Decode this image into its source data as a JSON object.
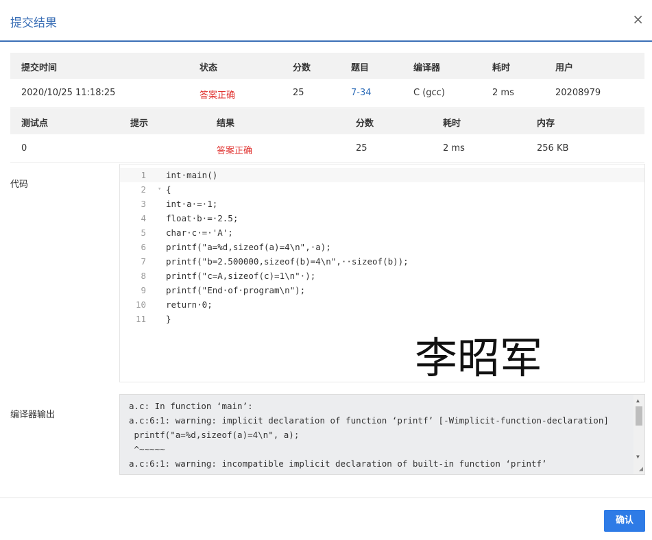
{
  "dialog": {
    "title": "提交结果",
    "close_glyph": "×",
    "confirm_label": "确认"
  },
  "submission": {
    "headers": [
      "提交时间",
      "状态",
      "分数",
      "题目",
      "编译器",
      "耗时",
      "用户"
    ],
    "row": {
      "time": "2020/10/25 11:18:25",
      "status": "答案正确",
      "score": "25",
      "problem": "7-34",
      "compiler": "C (gcc)",
      "elapsed": "2 ms",
      "user": "20208979"
    }
  },
  "testcases": {
    "headers": [
      "测试点",
      "提示",
      "结果",
      "分数",
      "耗时",
      "内存"
    ],
    "row": {
      "id": "0",
      "hint": "",
      "result": "答案正确",
      "score": "25",
      "elapsed": "2 ms",
      "memory": "256 KB"
    }
  },
  "code": {
    "label": "代码",
    "lines": [
      "int·main()",
      "{",
      "int·a·=·1;",
      "float·b·=·2.5;",
      "char·c·=·'A';",
      "printf(\"a=%d,sizeof(a)=4\\n\",·a);",
      "printf(\"b=2.500000,sizeof(b)=4\\n\",··sizeof(b));",
      "printf(\"c=A,sizeof(c)=1\\n\"·);",
      "printf(\"End·of·program\\n\");",
      "return·0;",
      "}"
    ],
    "line_numbers": [
      "1",
      "2",
      "3",
      "4",
      "5",
      "6",
      "7",
      "8",
      "9",
      "10",
      "11"
    ],
    "fold_glyph": "▾",
    "signature": "李昭军"
  },
  "compiler_output": {
    "label": "编译器输出",
    "lines": [
      "a.c: In function ‘main’:",
      "a.c:6:1: warning: implicit declaration of function ‘printf’ [-Wimplicit-function-declaration]",
      " printf(\"a=%d,sizeof(a)=4\\n\", a);",
      " ^~~~~~",
      "a.c:6:1: warning: incompatible implicit declaration of built-in function ‘printf’"
    ],
    "scroll_up": "▲",
    "scroll_down": "▼",
    "resize_grip": "◢"
  }
}
